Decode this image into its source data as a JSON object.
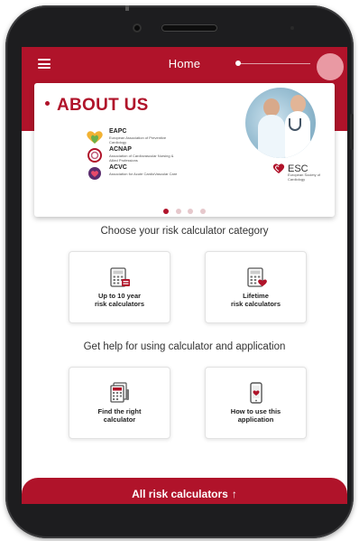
{
  "header": {
    "title": "Home",
    "menu_icon": "hamburger-menu-icon"
  },
  "banner": {
    "title": "ABOUT US",
    "orgs": [
      {
        "name": "EAPC",
        "subtitle": "European Association of Preventive Cardiology"
      },
      {
        "name": "ACNAP",
        "subtitle": "Association of Cardiovascular Nursing & Allied Professions"
      },
      {
        "name": "ACVC",
        "subtitle": "Association for Acute CardioVascular Care"
      }
    ],
    "esc_name": "ESC",
    "esc_subtitle": "European Society of Cardiology",
    "slides_total": 4,
    "active_slide": 1
  },
  "categories": {
    "title": "Choose your risk calculator category",
    "items": [
      {
        "label": "Up to 10 year\nrisk calculators",
        "icon": "calculator-icon"
      },
      {
        "label": "Lifetime\nrisk calculators",
        "icon": "calculator-heart-icon"
      }
    ]
  },
  "help": {
    "title": "Get help for using calculator and application",
    "items": [
      {
        "label": "Find the right\ncalculator",
        "icon": "calculator-list-icon"
      },
      {
        "label": "How to use this\napplication",
        "icon": "phone-heart-icon"
      }
    ]
  },
  "bottom_bar": {
    "label": "All risk calculators",
    "arrow": "↑"
  },
  "colors": {
    "brand": "#b0132a",
    "phone_frame": "#1d1d1f"
  }
}
